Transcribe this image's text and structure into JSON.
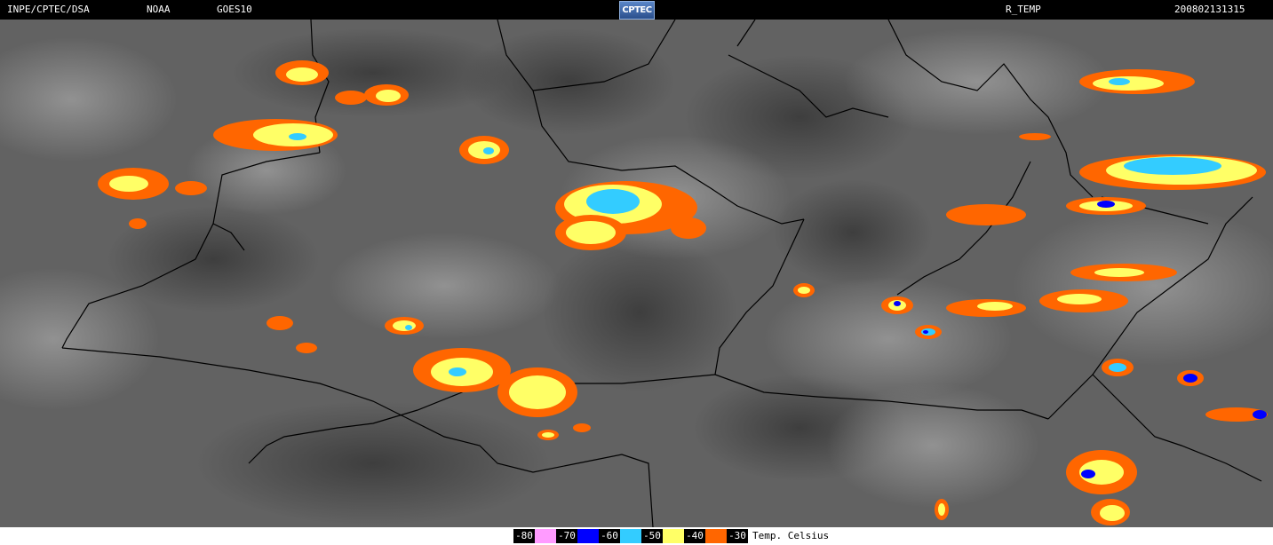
{
  "header": {
    "source": "INPE/CPTEC/DSA",
    "agency": "NOAA",
    "satellite": "GOES10",
    "logo_text": "CPTEC",
    "product": "R_TEMP",
    "timestamp": "200802131315"
  },
  "legend": {
    "items": [
      {
        "label": "-80",
        "color": "#ff9bff"
      },
      {
        "label": "-70",
        "color": "#0000ff"
      },
      {
        "label": "-60",
        "color": "#33ccff"
      },
      {
        "label": "-50",
        "color": "#ffff66"
      },
      {
        "label": "-40",
        "color": "#ff6600"
      },
      {
        "label": "-30",
        "color": ""
      }
    ],
    "unit": "Temp. Celsius"
  },
  "colors": {
    "background": "#000000",
    "cloud_gray": "#6a6a6a",
    "border_line": "#000000"
  }
}
